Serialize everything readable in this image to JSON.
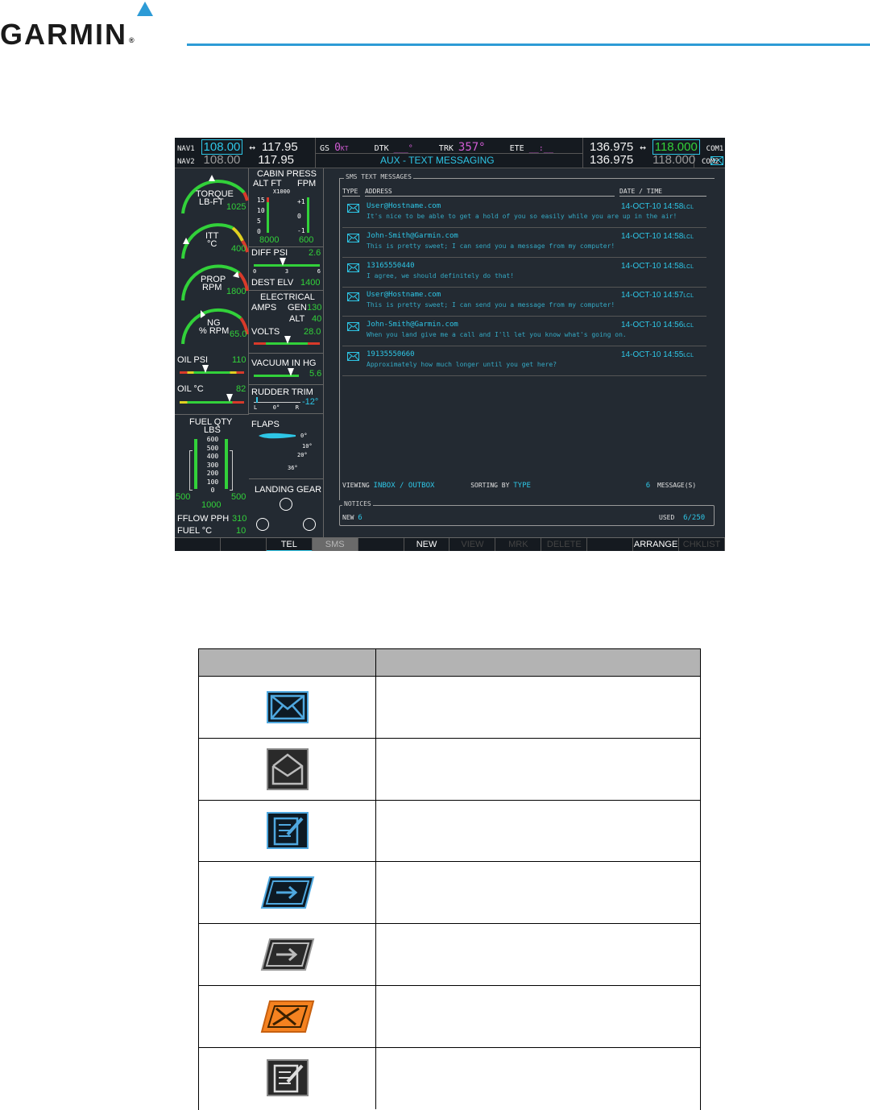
{
  "header": {
    "brand": "GARMIN",
    "registered": "®"
  },
  "topbar": {
    "nav1_label": "NAV1",
    "nav1_active": "108.00",
    "nav1_arrow": "↔",
    "nav1_standby": "117.95",
    "nav2_label": "NAV2",
    "nav2_active": "108.00",
    "nav2_standby": "117.95",
    "gs_label": "GS",
    "gs_value": "0",
    "gs_unit": "KT",
    "dtk_label": "DTK",
    "dtk_value": "___°",
    "trk_label": "TRK",
    "trk_value": "357°",
    "ete_label": "ETE",
    "ete_value": "__:__",
    "page_title": "AUX - TEXT MESSAGING",
    "com1_standby": "136.975",
    "com1_arrow": "↔",
    "com1_active": "118.000",
    "com1_label": "COM1",
    "com2_standby": "136.975",
    "com2_active": "118.000",
    "com2_label": "COM2"
  },
  "eis": {
    "torque_label_1": "TORQUE",
    "torque_label_2": "LB-FT",
    "torque_value": "1025",
    "itt_label_1": "ITT",
    "itt_label_2": "°C",
    "itt_value": "400",
    "prop_label_1": "PROP",
    "prop_label_2": "RPM",
    "prop_value": "1800",
    "ng_label_1": "NG",
    "ng_label_2": "% RPM",
    "ng_value": "65.0",
    "oil_psi_label": "OIL PSI",
    "oil_psi_value": "110",
    "oil_c_label": "OIL °C",
    "oil_c_value": "82",
    "fuel_qty_label_1": "FUEL QTY",
    "fuel_qty_label_2": "LBS",
    "fuel_scale": [
      "600",
      "500",
      "400",
      "300",
      "200",
      "100",
      "0"
    ],
    "fuel_left": "500",
    "fuel_right": "500",
    "fuel_total": "1000",
    "fflow_label": "FFLOW PPH",
    "fflow_value": "310",
    "fuel_c_label": "FUEL °C",
    "fuel_c_value": "10",
    "cabin_label": "CABIN PRESS",
    "alt_ft_label": "ALT FT",
    "fpm_label": "FPM",
    "x1000_label": "X1000",
    "cabin_scale_left": [
      "15",
      "10",
      "5",
      "0"
    ],
    "cabin_scale_right": [
      "+1",
      "0",
      "-1"
    ],
    "cabin_alt": "8000",
    "cabin_fpm": "600",
    "diff_psi_label": "DIFF PSI",
    "diff_psi_value": "2.6",
    "diff_scale": [
      "0",
      "3",
      "6"
    ],
    "dest_elv_label": "DEST ELV",
    "dest_elv_value": "1400",
    "electrical_label": "ELECTRICAL",
    "amps_label": "AMPS",
    "gen_label": "GEN",
    "gen_value": "130",
    "alt_label": "ALT",
    "alt_value": "40",
    "volts_label": "VOLTS",
    "volts_value": "28.0",
    "vacuum_label": "VACUUM IN HG",
    "vacuum_value": "5.6",
    "rudder_label": "RUDDER TRIM",
    "rudder_value": "-12°",
    "rudder_scale": [
      "L",
      "0°",
      "R"
    ],
    "flaps_label": "FLAPS",
    "flaps_marks": [
      "0°",
      "10°",
      "20°",
      "36°"
    ],
    "landing_gear_label": "LANDING GEAR"
  },
  "sms": {
    "group_title": "SMS TEXT MESSAGES",
    "col_type": "TYPE",
    "col_address": "ADDRESS",
    "col_date": "DATE / TIME",
    "messages": [
      {
        "address": "User@Hostname.com",
        "text": "It's nice to be able to get a hold of you so easily while you are up in the air!",
        "date": "14-OCT-10",
        "time": "14:58",
        "zone": "LCL"
      },
      {
        "address": "John-Smith@Garmin.com",
        "text": "This is pretty sweet; I can send you a message from my computer!",
        "date": "14-OCT-10",
        "time": "14:58",
        "zone": "LCL"
      },
      {
        "address": "13165550440",
        "text": "I agree, we should definitely do that!",
        "date": "14-OCT-10",
        "time": "14:58",
        "zone": "LCL"
      },
      {
        "address": "User@Hostname.com",
        "text": "This is pretty sweet; I can send you a message from my computer!",
        "date": "14-OCT-10",
        "time": "14:57",
        "zone": "LCL"
      },
      {
        "address": "John-Smith@Garmin.com",
        "text": "When you land give me a call and I'll let you know what's going on.",
        "date": "14-OCT-10",
        "time": "14:56",
        "zone": "LCL"
      },
      {
        "address": "19135550660",
        "text": "Approximately how much longer until you get here?",
        "date": "14-OCT-10",
        "time": "14:55",
        "zone": "LCL"
      }
    ],
    "viewing_label": "VIEWING",
    "viewing_value": "INBOX / OUTBOX",
    "sorting_label": "SORTING BY",
    "sorting_value": "TYPE",
    "message_count": "6",
    "messages_label": "MESSAGE(S)",
    "notices_title": "NOTICES",
    "new_label": "NEW",
    "new_value": "6",
    "used_label": "USED",
    "used_value": "6/250"
  },
  "softkeys": [
    "",
    "",
    "TEL",
    "SMS",
    "",
    "NEW",
    "VIEW",
    "MRK READ",
    "DELETE",
    "",
    "ARRANGE",
    "CHKLIST"
  ],
  "colors": {
    "accent": "#2d9bd6",
    "screen_bg": "#232a32",
    "cyan": "#2ec6e6",
    "green": "#32d13a",
    "magenta": "#d25cd4",
    "orange": "#f58220"
  },
  "icon_table": {
    "header_left": "",
    "header_right": "",
    "icons": [
      "envelope-new-icon",
      "envelope-read-icon",
      "draft-icon",
      "sent-icon",
      "sent-read-icon",
      "send-failed-icon",
      "draft-read-icon"
    ]
  }
}
